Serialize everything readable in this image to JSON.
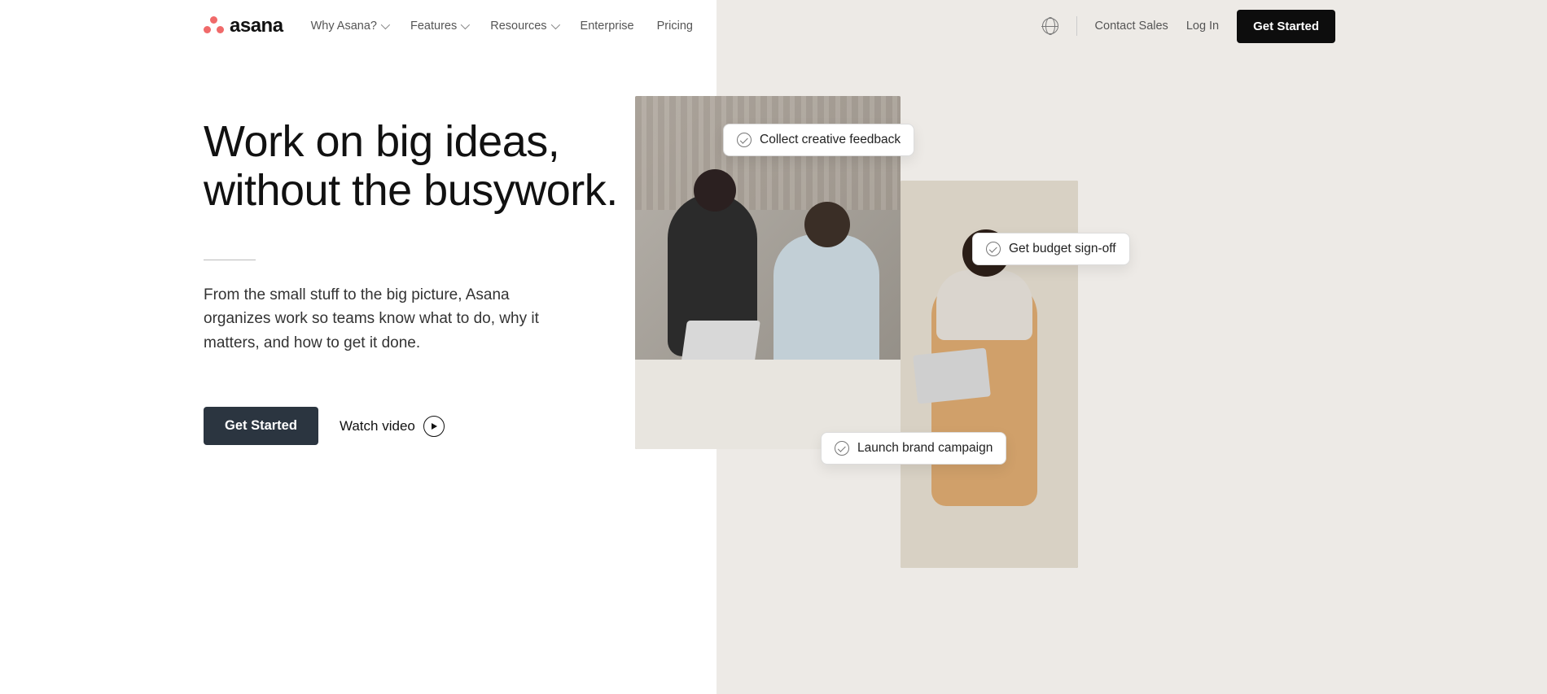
{
  "brand": {
    "name": "asana"
  },
  "nav": {
    "items": [
      {
        "label": "Why Asana?",
        "hasChevron": true
      },
      {
        "label": "Features",
        "hasChevron": true
      },
      {
        "label": "Resources",
        "hasChevron": true
      },
      {
        "label": "Enterprise",
        "hasChevron": false
      },
      {
        "label": "Pricing",
        "hasChevron": false
      }
    ],
    "contact": "Contact Sales",
    "login": "Log In",
    "cta": "Get Started"
  },
  "hero": {
    "headline_line1": "Work on big ideas,",
    "headline_line2": "without the busywork.",
    "sub": "From the small stuff to the big picture, Asana organizes work so teams know what to do, why it matters, and how to get it done.",
    "cta": "Get Started",
    "watch": "Watch video"
  },
  "chips": {
    "a": "Collect creative feedback",
    "b": "Get budget sign-off",
    "c": "Launch brand campaign"
  }
}
